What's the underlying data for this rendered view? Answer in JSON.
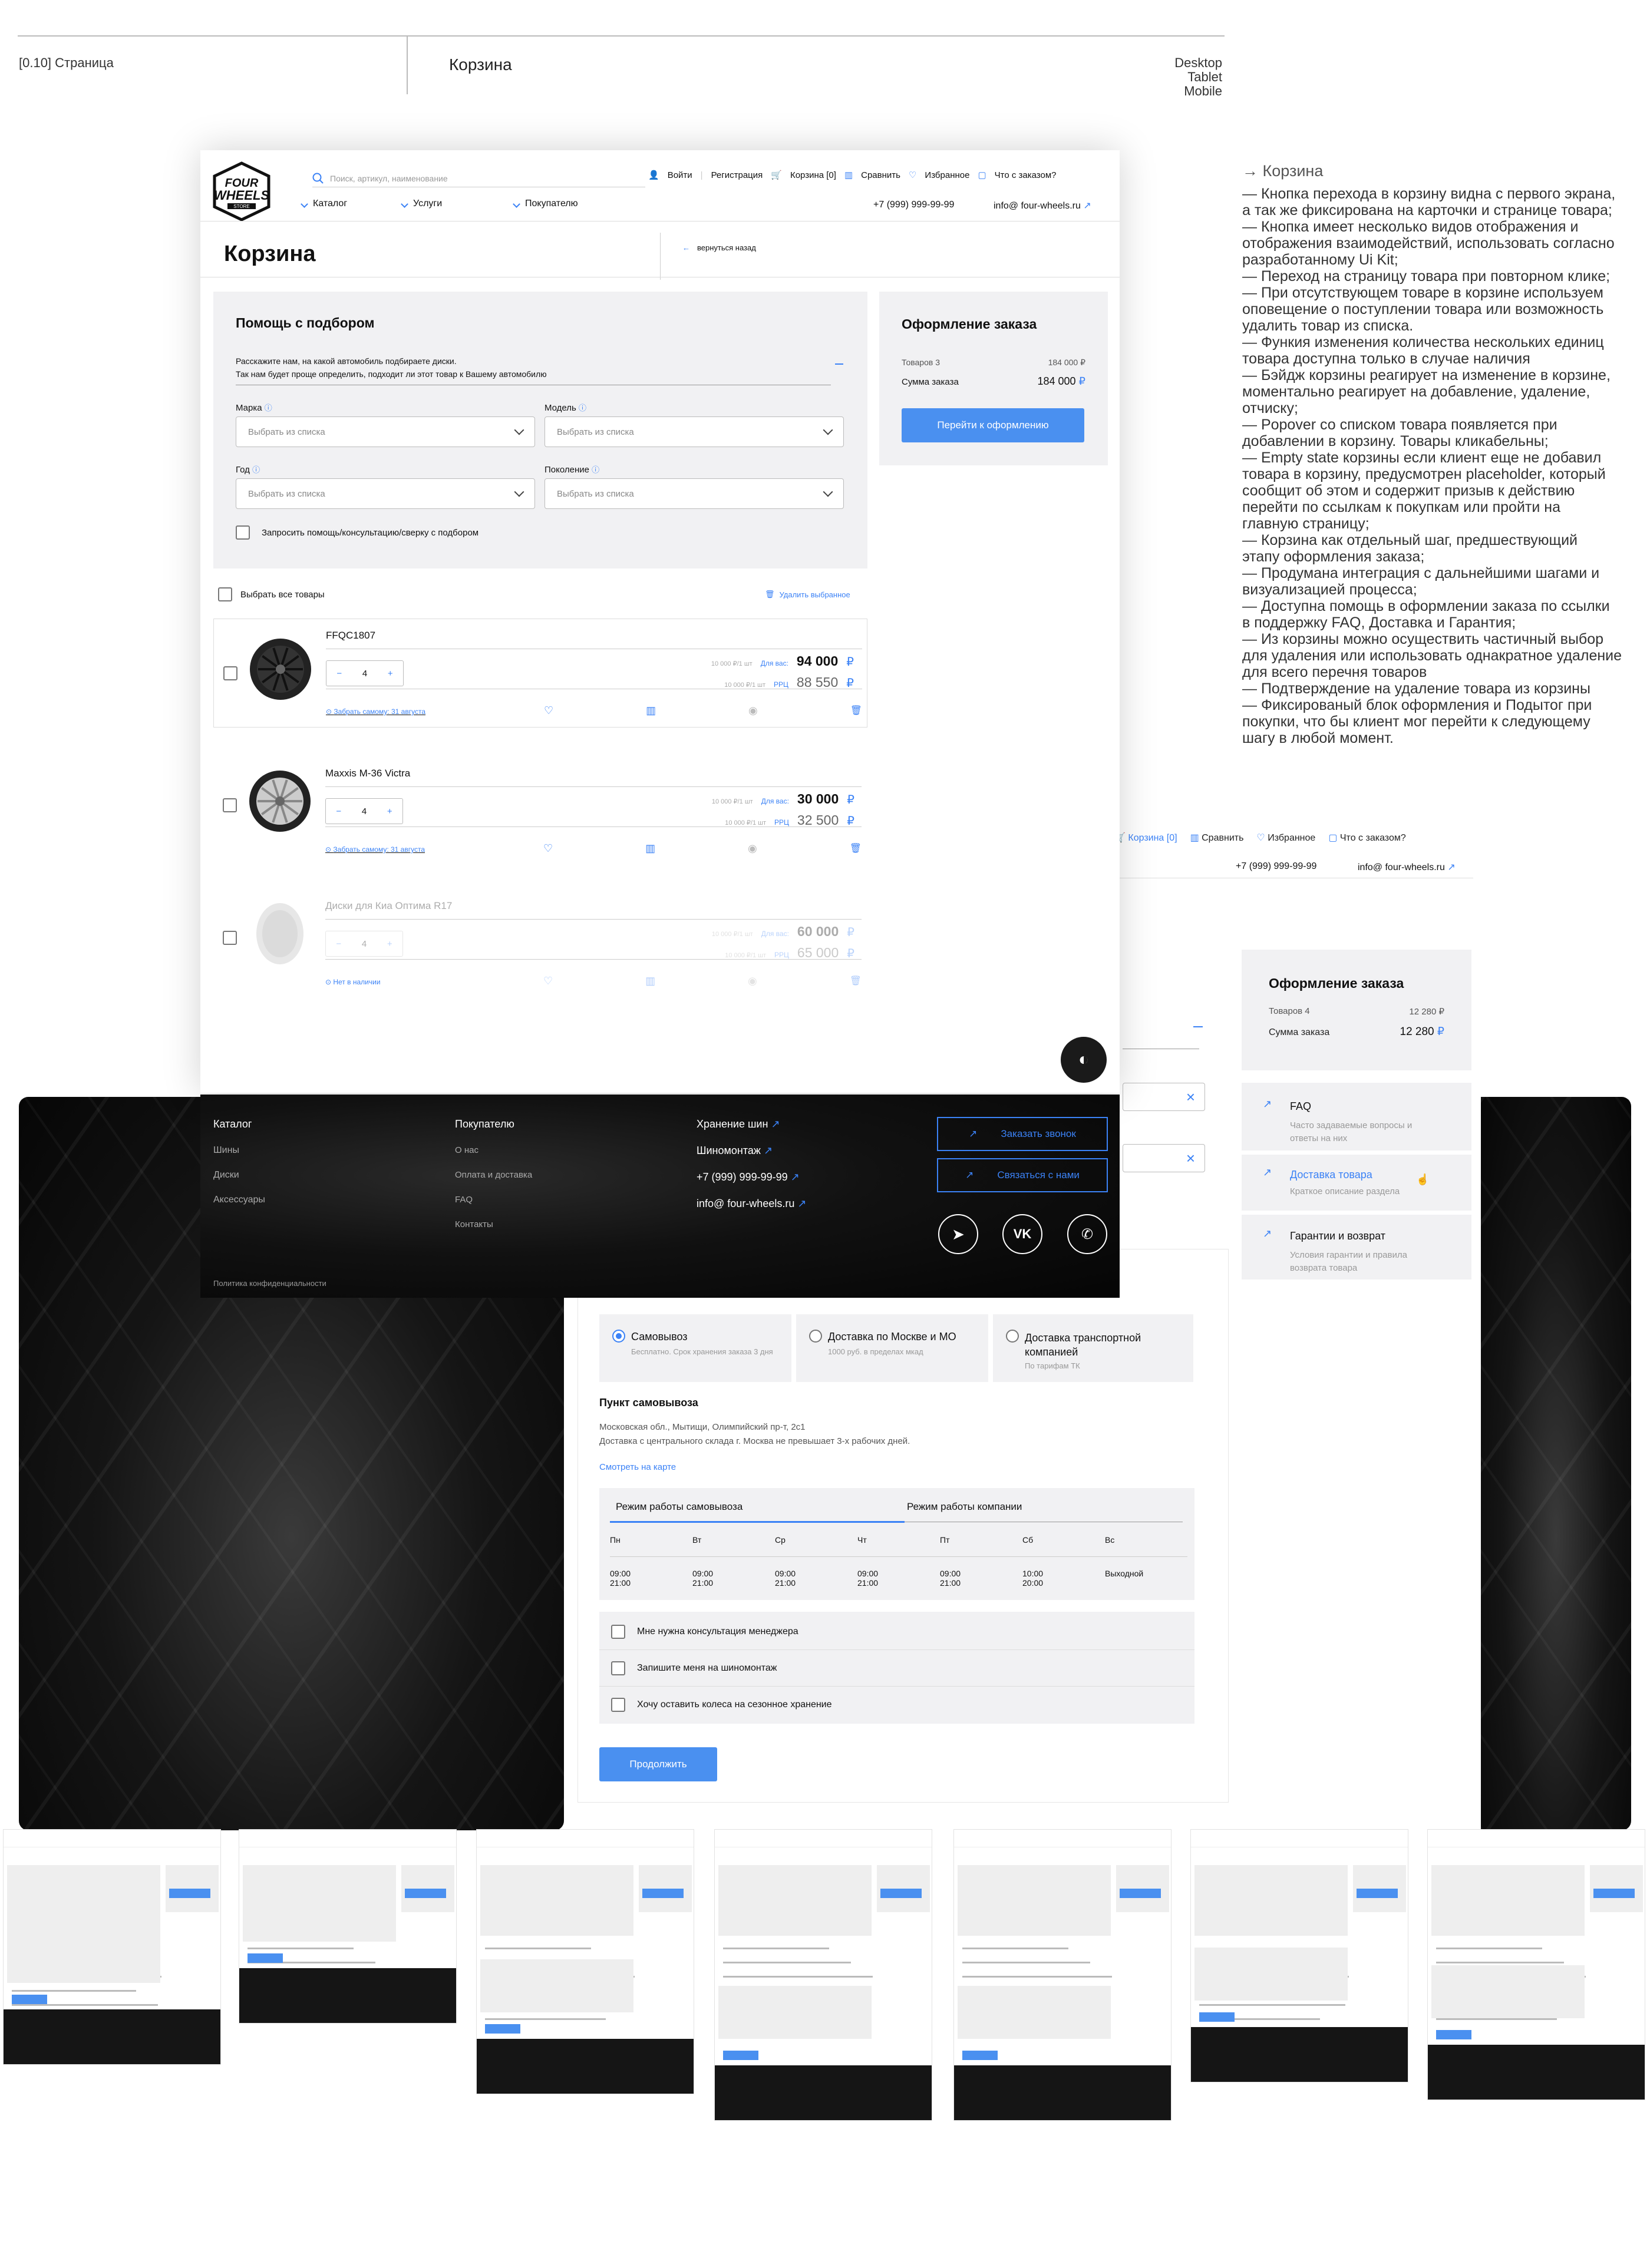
{
  "header": {
    "section_id": "[0.10] Страница",
    "section_title": "Корзина",
    "devices": [
      "Desktop",
      "Tablet",
      "Mobile"
    ]
  },
  "site": {
    "logo": "FOUR WHEELS STORE",
    "search_placeholder": "Поиск, артикул, наименование",
    "login": "Войти",
    "register": "Регистрация",
    "cart": "Корзина [0]",
    "compare": "Сравнить",
    "favorites": "Избранное",
    "order_status": "Что с заказом?",
    "nav": [
      "Каталог",
      "Услуги",
      "Покупателю"
    ],
    "phone": "+7 (999) 999-99-99",
    "email": "info@ four-wheels.ru"
  },
  "cart_page": {
    "title": "Корзина",
    "back": "вернуться назад",
    "help": {
      "title": "Помощь с подбором",
      "desc1": "Расскажите нам, на какой автомобиль подбираете диски.",
      "desc2": "Так нам будет проще определить, подходит ли этот товар к Вашему автомобилю",
      "fields": [
        {
          "label": "Марка",
          "placeholder": "Выбрать из списка"
        },
        {
          "label": "Модель",
          "placeholder": "Выбрать из списка"
        },
        {
          "label": "Год",
          "placeholder": "Выбрать из списка"
        },
        {
          "label": "Поколение",
          "placeholder": "Выбрать из списка"
        }
      ],
      "request_help": "Запросить помощь/консультацию/сверку с подбором"
    },
    "select_all": "Выбрать все товары",
    "delete_selected": "Удалить выбранное",
    "items": [
      {
        "name": "FFQC1807",
        "qty": "4",
        "unit1": "10 000 ₽/1 шт",
        "label1": "Для вас:",
        "price1": "94 000",
        "unit2": "10 000 ₽/1 шт",
        "label2": "РРЦ",
        "price2": "88 550",
        "pickup": "Забрать самому: 31 августа"
      },
      {
        "name": "Maxxis M-36 Victra",
        "qty": "4",
        "unit1": "10 000 ₽/1 шт",
        "label1": "Для вас:",
        "price1": "30 000",
        "unit2": "10 000 ₽/1 шт",
        "label2": "РРЦ",
        "price2": "32 500",
        "pickup": "Забрать самому: 31 августа"
      },
      {
        "name": "Диски для Киа Оптима R17",
        "qty": "4",
        "unit1": "10 000 ₽/1 шт",
        "label1": "Для вас:",
        "price1": "60 000",
        "unit2": "10 000 ₽/1 шт",
        "label2": "РРЦ",
        "price2": "65 000",
        "pickup": "Нет в наличии"
      }
    ],
    "summary": {
      "title": "Оформление заказа",
      "items_label": "Товаров 3",
      "items_value": "184 000 ₽",
      "sum_label": "Сумма заказа",
      "sum_value": "184 000",
      "checkout": "Перейти к оформлению"
    }
  },
  "footer": {
    "col1": {
      "title": "Каталог",
      "items": [
        "Шины",
        "Диски",
        "Аксессуары"
      ]
    },
    "col2": {
      "title": "Покупателю",
      "items": [
        "О нас",
        "Оплата и доставка",
        "FAQ",
        "Контакты"
      ]
    },
    "col3": [
      "Хранение шин",
      "Шиномонтаж",
      "+7 (999) 999-99-99",
      "info@ four-wheels.ru"
    ],
    "call": "Заказать звонок",
    "contact": "Связаться с нами",
    "privacy": "Политика конфиденциальности"
  },
  "notes": {
    "title": "→ Корзина",
    "lines": [
      "— Кнопка перехода в корзину видна с первого экрана,",
      "а так же фиксирована на карточки и странице товара;",
      "— Кнопка имеет несколько видов отображения и",
      "отображения взаимодействий, использовать согласно",
      "разработанному Ui Kit;",
      "— Переход на страницу товара при повторном клике;",
      "— При отсутствующем товаре в корзине используем",
      "оповещение о поступлении товара или возможность",
      "удалить товар из списка.",
      "— Функия изменения количества нескольких единиц",
      "товара доступна только в случае наличия",
      "— Бэйдж корзины реагирует на изменение в корзине,",
      "моментально реагирует на добавление, удаление,",
      "отчиску;",
      "—  Popover со списком товара появляется при",
      "добавлении в корзину. Товары кликабельны;",
      "—  Empty state корзины если клиент еще не добавил",
      "товара в корзину, предусмотрен placeholder, который",
      "сообщит об этом и содержит призыв к действию",
      "перейти по ссылкам к покупкам или пройти на",
      "главную страницу;",
      "—  Корзина как отдельный шаг, предшествующий",
      "этапу оформления заказа;",
      "—  Продумана интеграция с дальнейшими шагами и",
      "визуализацией процесса;",
      "—  Доступна помощь в оформлении заказа по ссылки",
      "в поддержку FAQ, Доставка и Гарантия;",
      "—  Из корзины можно осуществить частичный выбор",
      "для удаления или использовать однакратное удаление",
      "для всего перечня товаров",
      "— Подтверждение на удаление товара из корзины",
      "— Фиксированый блок оформления и Подытог при",
      "покупки, что бы клиент мог перейти к следующему",
      "шагу в любой момент."
    ]
  },
  "second_page": {
    "top_links": [
      "Корзина [0]",
      "Сравнить",
      "Избранное",
      "Что с заказом?"
    ],
    "phone": "+7 (999) 999-99-99",
    "email": "info@ four-wheels.ru",
    "summary": {
      "title": "Оформление заказа",
      "items_label": "Товаров 4",
      "items_value": "12 280 ₽",
      "sum_label": "Сумма заказа",
      "sum_value": "12 280"
    },
    "help_links": [
      {
        "title": "FAQ",
        "sub": "Часто задаваемые вопросы и ответы на них"
      },
      {
        "title": "Доставка товара",
        "sub": "Краткое описание раздела"
      },
      {
        "title": "Гарантии и возврат",
        "sub": "Условия гарантии и правила возврата товара"
      }
    ],
    "delivery_options": [
      {
        "title": "Самовывоз",
        "sub": "Бесплатно. Срок хранения заказа 3 дня"
      },
      {
        "title": "Доставка по Москве и МО",
        "sub": "1000 руб. в пределах мкад"
      },
      {
        "title": "Доставка транспортной компанией",
        "sub": "По тарифам ТК"
      }
    ],
    "pickup_title": "Пункт самовывоза",
    "pickup_addr": "Московская обл., Мытищи, Олимпийский пр-т, 2с1",
    "pickup_note": "Доставка с центрального склада г. Москва не превышает 3-х рабочих дней.",
    "map_link": "Смотреть на карте",
    "tabs": [
      "Режим работы самовывоза",
      "Режим работы компании"
    ],
    "days": [
      "Пн",
      "Вт",
      "Ср",
      "Чт",
      "Пт",
      "Сб",
      "Вс"
    ],
    "hours_open": [
      "09:00",
      "09:00",
      "09:00",
      "09:00",
      "09:00",
      "10:00",
      "Выходной"
    ],
    "hours_close": [
      "21:00",
      "21:00",
      "21:00",
      "21:00",
      "21:00",
      "20:00",
      ""
    ],
    "options": [
      "Мне нужна консультация менеджера",
      "Запишите меня на шиномонтаж",
      "Хочу оставить колеса на сезонное хранение"
    ],
    "continue": "Продолжить"
  },
  "colors": {
    "accent": "#4a90f0",
    "dark": "#151515",
    "panel": "#f1f1f3"
  }
}
